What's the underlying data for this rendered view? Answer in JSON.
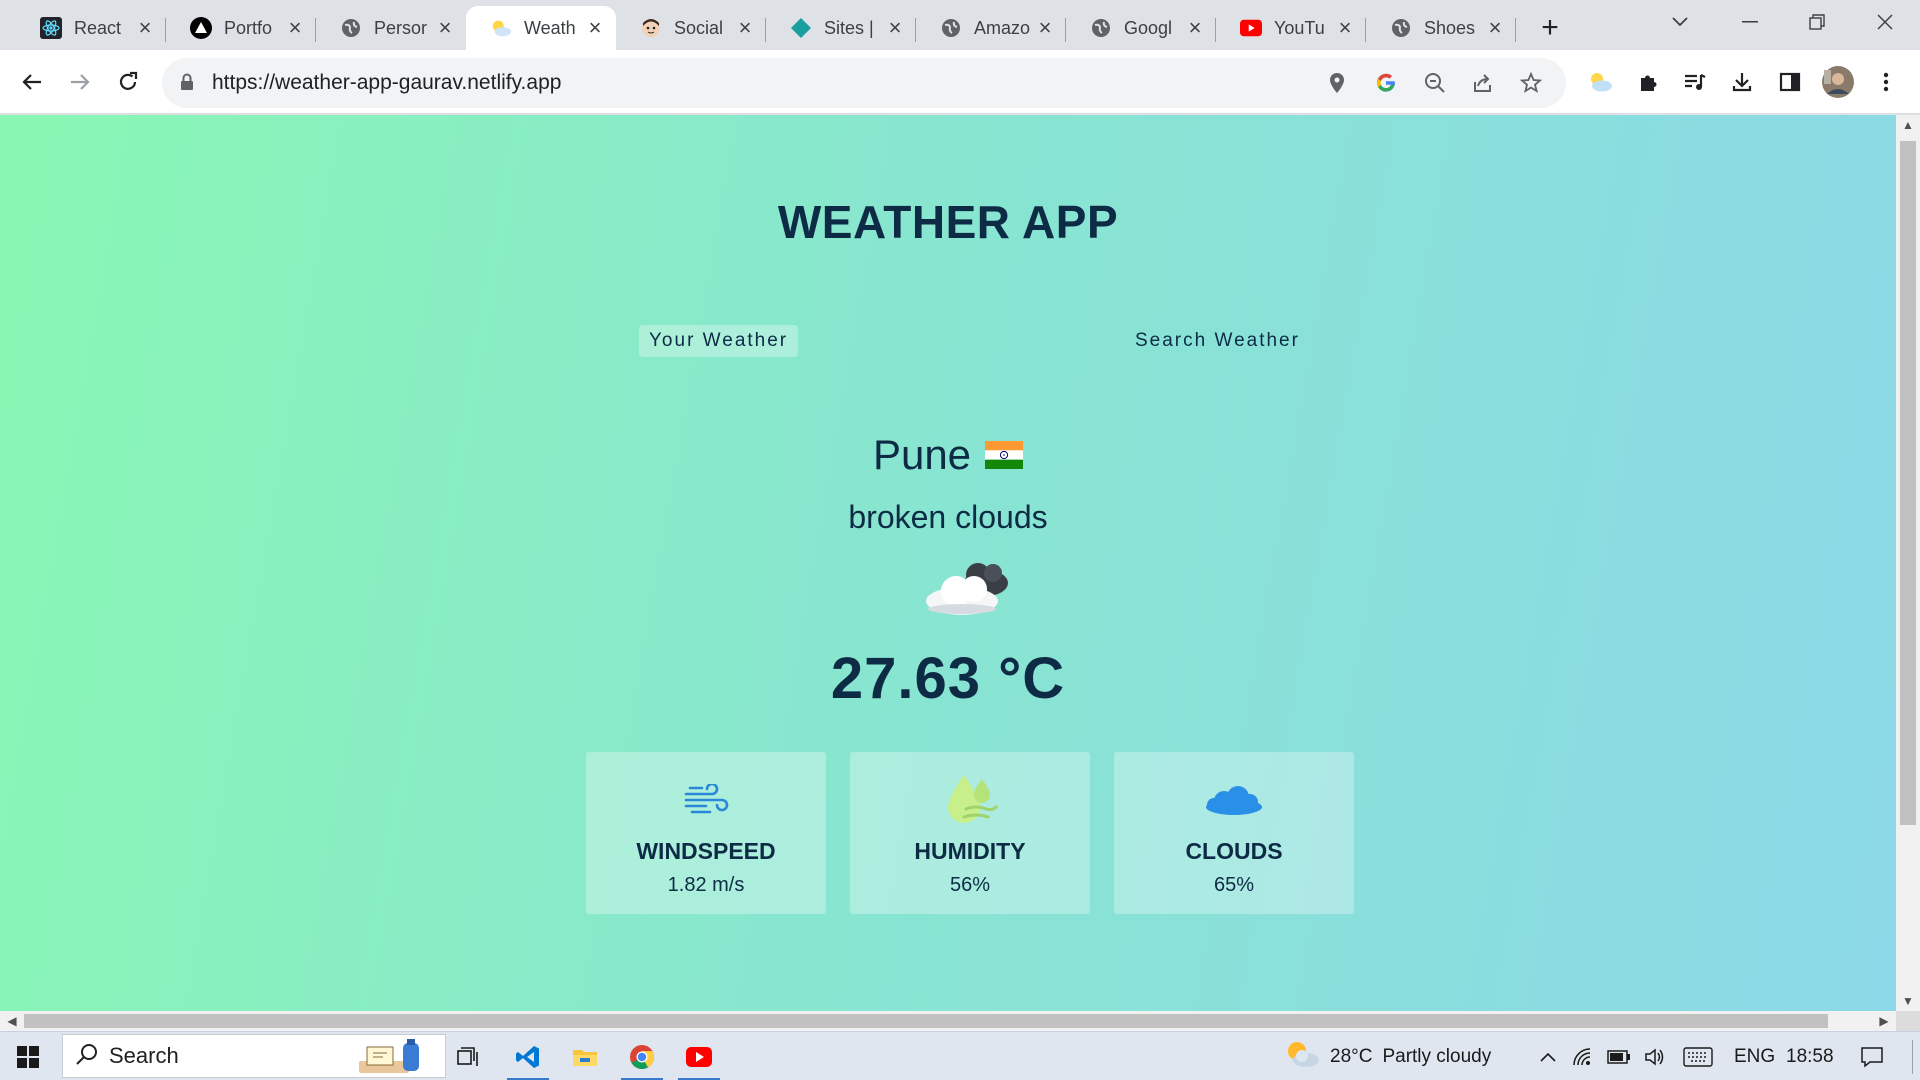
{
  "tabs": [
    {
      "title": "React",
      "icon": "react-icon",
      "active": false
    },
    {
      "title": "Portfo",
      "icon": "triangle-logo-icon",
      "active": false
    },
    {
      "title": "Persor",
      "icon": "globe-icon",
      "active": false
    },
    {
      "title": "Weath",
      "icon": "weather-favicon-icon",
      "active": true
    },
    {
      "title": "Social",
      "icon": "avatar-favicon-icon",
      "active": false
    },
    {
      "title": "Sites |",
      "icon": "diamond-favicon-icon",
      "active": false
    },
    {
      "title": "Amazo",
      "icon": "globe-icon",
      "active": false
    },
    {
      "title": "Googl",
      "icon": "globe-icon",
      "active": false
    },
    {
      "title": "YouTu",
      "icon": "youtube-icon",
      "active": false
    },
    {
      "title": "Shoes",
      "icon": "globe-icon",
      "active": false
    }
  ],
  "address_bar": {
    "url": "https://weather-app-gaurav.netlify.app"
  },
  "page": {
    "title": "WEATHER APP",
    "nav": {
      "your_weather": "Your Weather",
      "search_weather": "Search Weather",
      "active": "your_weather"
    },
    "weather": {
      "city": "Pune",
      "country_flag": "🇮🇳",
      "description": "broken clouds",
      "icon": "broken-clouds-icon",
      "temperature": "27.63 °C"
    },
    "stats": [
      {
        "label": "WINDSPEED",
        "value": "1.82 m/s",
        "icon": "wind-icon"
      },
      {
        "label": "HUMIDITY",
        "value": "56%",
        "icon": "humidity-icon"
      },
      {
        "label": "CLOUDS",
        "value": "65%",
        "icon": "cloud-icon"
      }
    ]
  },
  "taskbar": {
    "search_label": "Search",
    "weather": {
      "temp": "28°C",
      "condition": "Partly cloudy"
    },
    "language": "ENG",
    "time": "18:58"
  },
  "colors": {
    "accent_text": "#0d2b45",
    "gradient_start": "#89f7b3",
    "gradient_end": "#8cd8e8"
  }
}
